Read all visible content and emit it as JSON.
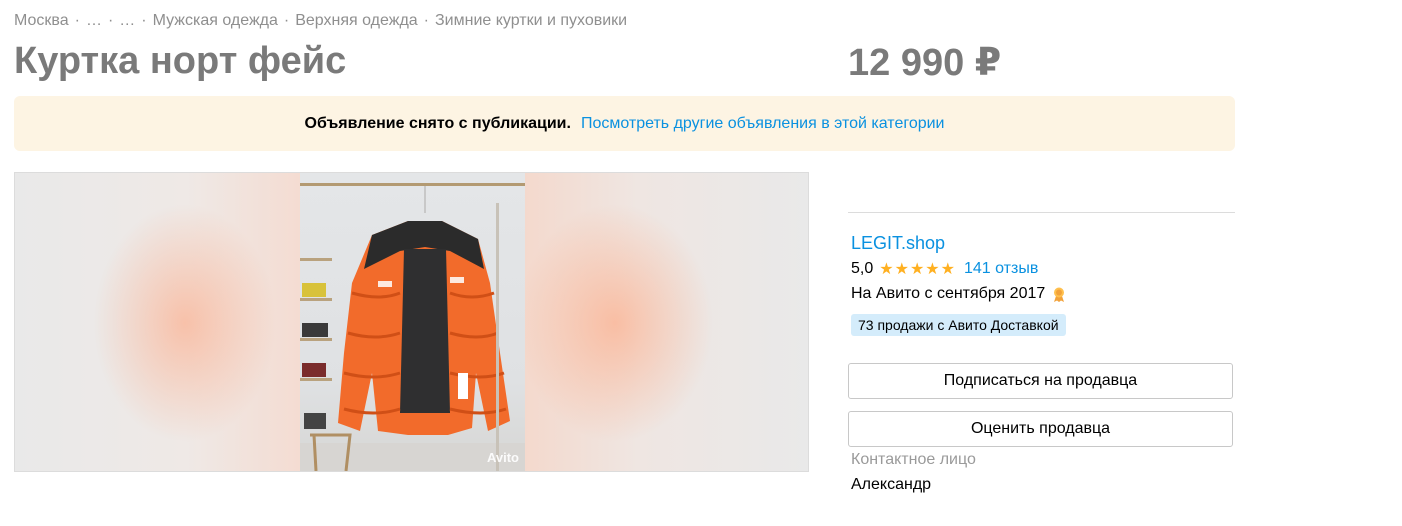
{
  "breadcrumbs": [
    "Москва",
    "…",
    "…",
    "Мужская одежда",
    "Верхняя одежда",
    "Зимние куртки и пуховики"
  ],
  "title": "Куртка норт фейс",
  "price": "12 990 ₽",
  "notice": {
    "text": "Объявление снято с публикации.",
    "link": "Посмотреть другие объявления в этой категории"
  },
  "gallery": {
    "watermark": "Avito"
  },
  "seller": {
    "name": "LEGIT.shop",
    "rating": "5,0",
    "stars": "★★★★★",
    "reviews": "141 отзыв",
    "since": "На Авито с сентября 2017",
    "delivery_badge": "73 продажи с Авито Доставкой",
    "subscribe_button": "Подписаться на продавца",
    "rate_button": "Оценить продавца",
    "contact_label": "Контактное лицо",
    "contact_name": "Александр"
  },
  "colors": {
    "link": "#0a91e0",
    "notice_bg": "#fdf4e3",
    "badge_bg": "#d4ecfb",
    "star": "#ffb021"
  }
}
